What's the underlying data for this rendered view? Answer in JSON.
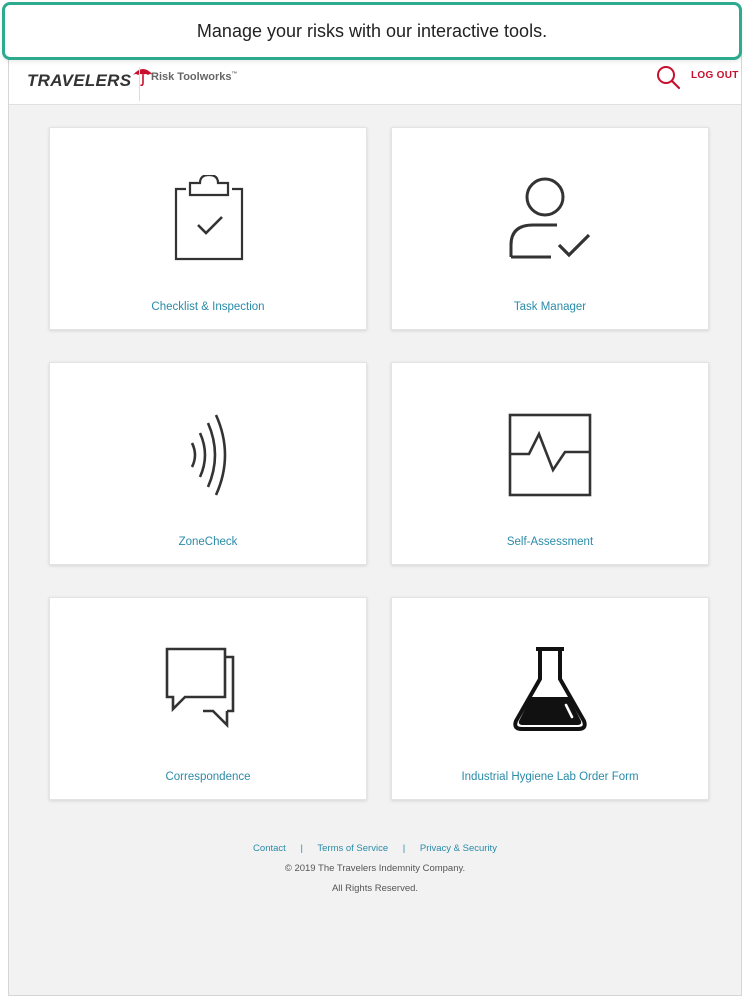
{
  "banner": {
    "text": "Manage your risks with our interactive tools."
  },
  "header": {
    "logo_text": "TRAVELERS",
    "product_name": "Risk Toolworks",
    "product_mark": "™",
    "logout_label": "LOG OUT"
  },
  "tiles": [
    {
      "label": "Checklist & Inspection",
      "icon": "clipboard-check-icon"
    },
    {
      "label": "Task Manager",
      "icon": "person-check-icon"
    },
    {
      "label": "ZoneCheck",
      "icon": "signal-waves-icon"
    },
    {
      "label": "Self-Assessment",
      "icon": "heartbeat-chart-icon"
    },
    {
      "label": "Correspondence",
      "icon": "chat-bubbles-icon"
    },
    {
      "label": "Industrial Hygiene Lab Order Form",
      "icon": "lab-flask-icon"
    }
  ],
  "footer": {
    "links": [
      "Contact",
      "Terms of Service",
      "Privacy & Security"
    ],
    "separator": "|",
    "copyright": "© 2019 The Travelers Indemnity Company.",
    "rights": "All Rights Reserved."
  },
  "colors": {
    "brand_red": "#c8102e",
    "link_teal": "#2a8ba8",
    "banner_border": "#2eaa8e",
    "page_bg": "#f2f2f2"
  }
}
